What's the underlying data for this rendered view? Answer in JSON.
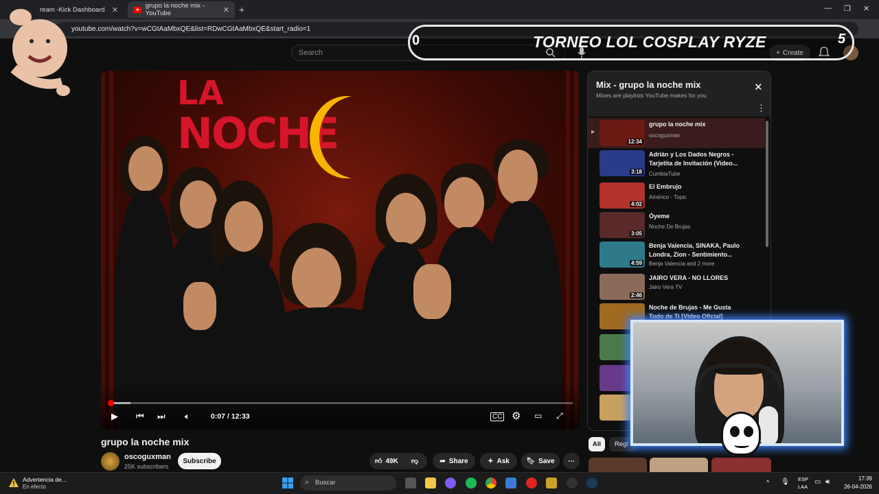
{
  "browser": {
    "tabs": [
      {
        "label": "Kick Dashboard",
        "prefix": "ream - "
      },
      {
        "label": "grupo la noche mix - YouTube"
      }
    ],
    "new_tab": "+",
    "url": "youtube.com/watch?v=wCGtAaMbxQE&list=RDwCGtAaMbxQE&start_radio=1"
  },
  "youtube_header": {
    "search_placeholder": "Search",
    "create_label": "Create"
  },
  "overlay": {
    "banner_text": "TORNEO LOL COSPLAY RYZE",
    "banner_left": "0",
    "banner_right": "5"
  },
  "video": {
    "logo_top": "LA",
    "logo_bottom": "NOCHE",
    "time_current": "0:07",
    "time_total": "12:33",
    "time_display": "0:07 / 12:33",
    "progress_fraction": 0.0093,
    "title": "grupo la noche mix",
    "channel": "oscoguxman",
    "subscribers": "25K subscribers",
    "subscribe_label": "Subscribe",
    "likes": "49K",
    "share_label": "Share",
    "ask_label": "Ask",
    "save_label": "Save"
  },
  "playlist": {
    "title": "Mix - grupo la noche mix",
    "subtitle": "Mixes are playlists YouTube makes for you",
    "items": [
      {
        "title": "grupo la noche mix",
        "channel": "oscoguxman",
        "duration": "12:34",
        "thumb": "#6b1a14"
      },
      {
        "title": "Adrián y Los Dados Negros - Tarjetita de Invitación (Video...",
        "channel": "CumbiaTube",
        "duration": "3:18",
        "thumb": "#2a3b8a"
      },
      {
        "title": "El Embrujo",
        "channel": "Américo - Topic",
        "duration": "4:02",
        "thumb": "#b4322c"
      },
      {
        "title": "Óyeme",
        "channel": "Noche De Brujas",
        "duration": "3:05",
        "thumb": "#5a2a2a"
      },
      {
        "title": "Benja Valencia, SINAKA, Paulo Londra, Zion - Sentimiento...",
        "channel": "Benja Valencia and 2 more",
        "duration": "4:59",
        "thumb": "#2f7a8a"
      },
      {
        "title": "JAIRO VERA - NO LLORES",
        "channel": "Jairo Vera TV",
        "duration": "2:46",
        "thumb": "#8a6a5a"
      },
      {
        "title": "Noche de Brujas - Me Gusta Todo de Ti [Video Oficial]",
        "channel": "",
        "duration": "",
        "thumb": "#a06a20"
      }
    ],
    "chip_all": "All",
    "chip_next": "Regi"
  },
  "taskbar": {
    "warning_title": "Advertencia de...",
    "warning_sub": "En efecto",
    "search": "Buscar",
    "lang1": "ESP",
    "lang2": "LAA",
    "time": "17:39",
    "date": "26-04-2026"
  },
  "colors": {
    "accent_red": "#ff0000",
    "background": "#0f0f0f",
    "cam_glow": "#3b82ff"
  }
}
